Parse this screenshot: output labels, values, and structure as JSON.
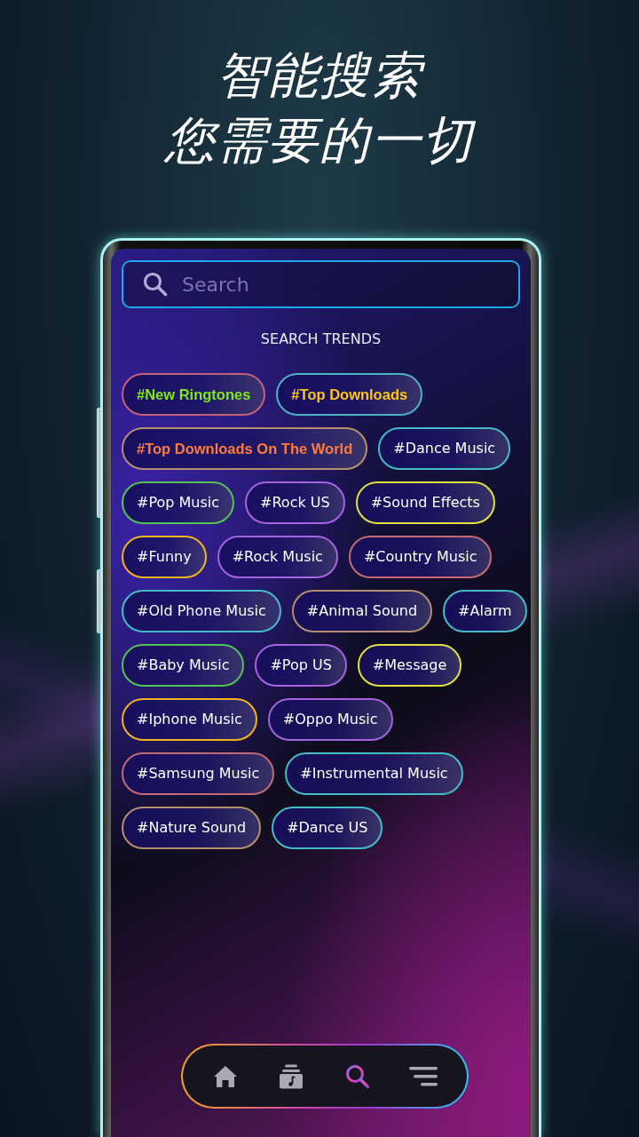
{
  "headline": [
    "智能搜索",
    "您需要的一切"
  ],
  "search": {
    "placeholder": "Search"
  },
  "section_title": "SEARCH TRENDS",
  "trend_rows": [
    [
      {
        "label": "#New Ringtones",
        "color": "#c4607a",
        "highlight": {
          "color": "#7ee81c"
        }
      },
      {
        "label": "#Top Downloads",
        "color": "#4ab4c4",
        "highlight": {
          "color": "#ffc414"
        }
      }
    ],
    [
      {
        "label": "#Top Downloads On The World",
        "color": "#b4906e",
        "highlight": {
          "color": "#ff7a3a"
        }
      },
      {
        "label": "#Dance Music",
        "color": "#44bcc8"
      }
    ],
    [
      {
        "label": "#Pop Music",
        "color": "#52c452"
      },
      {
        "label": "#Rock US",
        "color": "#a464e0"
      },
      {
        "label": "#Sound Effects",
        "color": "#e2e040"
      }
    ],
    [
      {
        "label": "#Funny",
        "color": "#f0b420"
      },
      {
        "label": "#Rock Music",
        "color": "#a464e0"
      },
      {
        "label": "#Country Music",
        "color": "#c46a74"
      }
    ],
    [
      {
        "label": "#Old Phone Music",
        "color": "#44bcc8"
      },
      {
        "label": "#Animal Sound",
        "color": "#b4906e"
      },
      {
        "label": "#Alarm",
        "color": "#44bcc8"
      }
    ],
    [
      {
        "label": "#Baby Music",
        "color": "#52c452"
      },
      {
        "label": "#Pop US",
        "color": "#a464e0"
      },
      {
        "label": "#Message",
        "color": "#e2e040"
      }
    ],
    [
      {
        "label": "#Iphone Music",
        "color": "#f0b420"
      },
      {
        "label": "#Oppo Music",
        "color": "#a464e0"
      }
    ],
    [
      {
        "label": "#Samsung Music",
        "color": "#c46a74"
      },
      {
        "label": "#Instrumental Music",
        "color": "#44bcc8"
      }
    ],
    [
      {
        "label": "#Nature Sound",
        "color": "#b4906e"
      },
      {
        "label": "#Dance US",
        "color": "#44bcc8"
      }
    ]
  ],
  "bottom_nav": [
    {
      "kind": "home",
      "selected": false
    },
    {
      "kind": "library",
      "selected": false
    },
    {
      "kind": "search",
      "selected": true
    },
    {
      "kind": "menu",
      "selected": false
    }
  ]
}
